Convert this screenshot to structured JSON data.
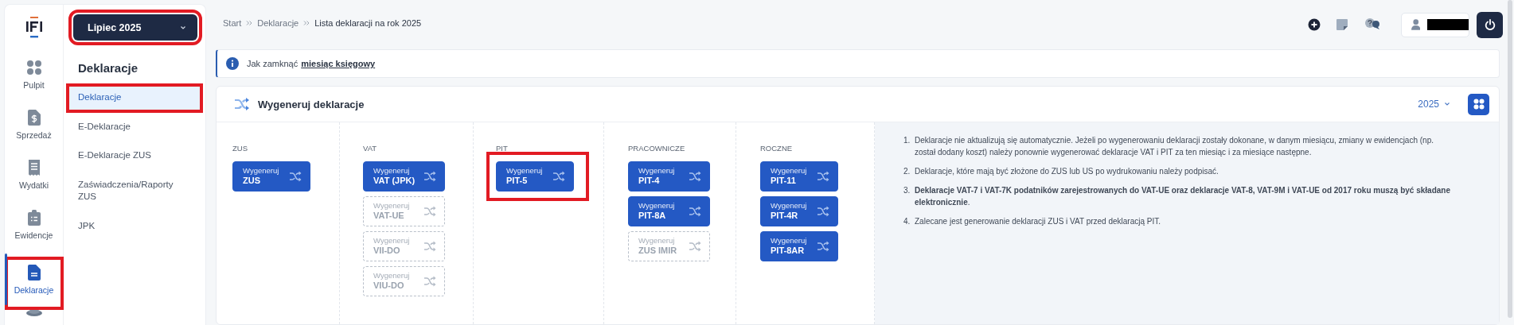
{
  "rail": {
    "items": [
      {
        "label": "Pulpit",
        "selected": false,
        "highlighted": false
      },
      {
        "label": "Sprzedaż",
        "selected": false,
        "highlighted": false
      },
      {
        "label": "Wydatki",
        "selected": false,
        "highlighted": false
      },
      {
        "label": "Ewidencje",
        "selected": false,
        "highlighted": false
      },
      {
        "label": "Deklaracje",
        "selected": true,
        "highlighted": true
      }
    ]
  },
  "submenu": {
    "month": {
      "label": "Lipiec 2025",
      "highlighted": true
    },
    "title": "Deklaracje",
    "items": [
      {
        "label": "Deklaracje",
        "selected": true,
        "highlighted": true
      },
      {
        "label": "E-Deklaracje",
        "selected": false,
        "highlighted": false
      },
      {
        "label": "E-Deklaracje ZUS",
        "selected": false,
        "highlighted": false
      },
      {
        "label": "Zaświadczenia/Raporty ZUS",
        "selected": false,
        "highlighted": false
      },
      {
        "label": "JPK",
        "selected": false,
        "highlighted": false
      }
    ]
  },
  "breadcrumb": [
    "Start",
    "Deklaracje",
    "Lista deklaracji na rok 2025"
  ],
  "info": {
    "text": "Jak zamknąć",
    "link": "miesiąc księgowy"
  },
  "card": {
    "title": "Wygeneruj deklaracje",
    "year": "2025",
    "groups": [
      {
        "title": "ZUS",
        "buttons": [
          {
            "action": "Wygeneruj",
            "label": "ZUS",
            "disabled": false,
            "highlighted": false
          }
        ]
      },
      {
        "title": "VAT",
        "buttons": [
          {
            "action": "Wygeneruj",
            "label": "VAT (JPK)",
            "disabled": false,
            "highlighted": false
          },
          {
            "action": "Wygeneruj",
            "label": "VAT-UE",
            "disabled": true,
            "highlighted": false
          },
          {
            "action": "Wygeneruj",
            "label": "VII-DO",
            "disabled": true,
            "highlighted": false
          },
          {
            "action": "Wygeneruj",
            "label": "VIU-DO",
            "disabled": true,
            "highlighted": false
          }
        ]
      },
      {
        "title": "PIT",
        "buttons": [
          {
            "action": "Wygeneruj",
            "label": "PIT-5",
            "disabled": false,
            "highlighted": true
          }
        ]
      },
      {
        "title": "PRACOWNICZE",
        "buttons": [
          {
            "action": "Wygeneruj",
            "label": "PIT-4",
            "disabled": false,
            "highlighted": false
          },
          {
            "action": "Wygeneruj",
            "label": "PIT-8A",
            "disabled": false,
            "highlighted": false
          },
          {
            "action": "Wygeneruj",
            "label": "ZUS IMIR",
            "disabled": true,
            "highlighted": false
          }
        ]
      },
      {
        "title": "ROCZNE",
        "buttons": [
          {
            "action": "Wygeneruj",
            "label": "PIT-11",
            "disabled": false,
            "highlighted": false
          },
          {
            "action": "Wygeneruj",
            "label": "PIT-4R",
            "disabled": false,
            "highlighted": false
          },
          {
            "action": "Wygeneruj",
            "label": "PIT-8AR",
            "disabled": false,
            "highlighted": false
          }
        ]
      }
    ],
    "notes": [
      {
        "number": "1.",
        "text": "Deklaracje nie aktualizują się automatycznie. Jeżeli po wygenerowaniu deklaracji zostały dokonane, w danym miesiącu, zmiany w ewidencjach (np. został dodany koszt) należy ponownie wygenerować deklaracje VAT i PIT za ten miesiąc i za miesiące następne."
      },
      {
        "number": "2.",
        "text": "Deklaracje, które mają być złożone do ZUS lub US po wydrukowaniu należy podpisać."
      },
      {
        "number": "3.",
        "text": "**Deklaracje VAT-7 i VAT-7K podatników zarejestrowanych do VAT-UE oraz deklaracje VAT-8, VAT-9M i VAT-UE od 2017 roku muszą być składane elektronicznie**."
      },
      {
        "number": "4.",
        "text": "Zalecane jest generowanie deklaracji ZUS i VAT przed deklaracją PIT."
      }
    ]
  }
}
